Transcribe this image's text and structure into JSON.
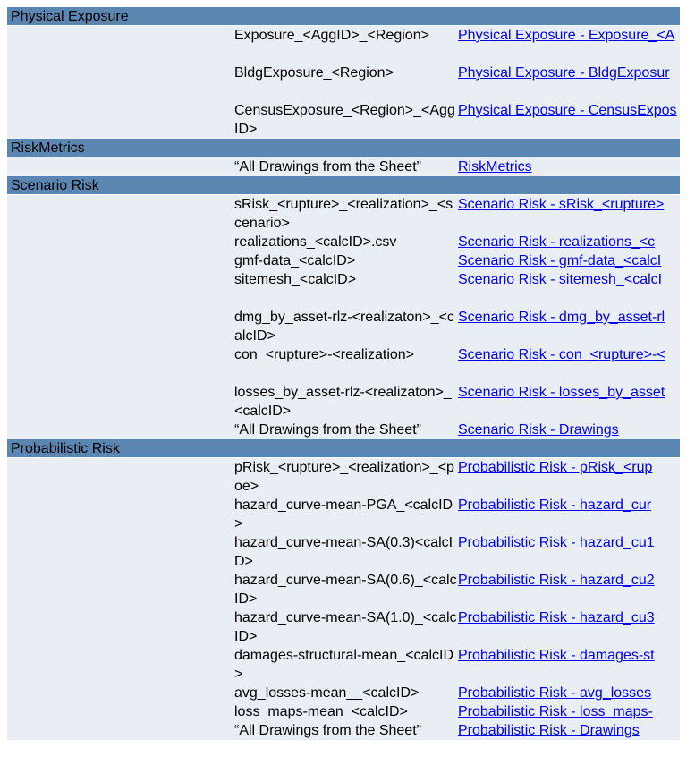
{
  "sections": [
    {
      "title": "Physical Exposure",
      "rows": [
        {
          "name": "Exposure_<AggID>_<Region>",
          "link": "Physical Exposure - Exposure_<A",
          "h": 2,
          "wrap": true
        },
        {
          "name": "BldgExposure_<Region>",
          "link": "Physical Exposure - BldgExposur",
          "h": 2,
          "wrap": false
        },
        {
          "name": "CensusExposure_<Region>_<AggID>",
          "link": "Physical Exposure - CensusExpos",
          "h": 2,
          "wrap": true
        }
      ]
    },
    {
      "title": "RiskMetrics",
      "rows": [
        {
          "name": "“All Drawings from the Sheet”",
          "link": "RiskMetrics",
          "h": 1,
          "wrap": false
        }
      ]
    },
    {
      "title": "Scenario Risk",
      "rows": [
        {
          "name": "sRisk_<rupture>_<realization>_<scenario>",
          "link": "Scenario Risk - sRisk_<rupture>",
          "h": 2,
          "wrap": false
        },
        {
          "name": "realizations_<calcID>.csv",
          "link": "Scenario Risk - realizations_<c",
          "h": 1,
          "wrap": false
        },
        {
          "name": "gmf-data_<calcID>",
          "link": "Scenario Risk - gmf-data_<calcI",
          "h": 1,
          "wrap": false
        },
        {
          "name": "sitemesh_<calcID>",
          "link": "Scenario Risk - sitemesh_<calcI",
          "h": 2,
          "wrap": false
        },
        {
          "name": "dmg_by_asset-rlz-<realizaton>_<calcID>",
          "link": "Scenario Risk - dmg_by_asset-rl",
          "h": 2,
          "wrap": false
        },
        {
          "name": "con_<rupture>-<realization>",
          "link": "Scenario Risk - con_<rupture>-<",
          "h": 2,
          "wrap": false
        },
        {
          "name": "losses_by_asset-rlz-<realizaton>_<calcID>",
          "link": "Scenario Risk - losses_by_asset",
          "h": 2,
          "wrap": false
        },
        {
          "name": "“All Drawings from the Sheet”",
          "link": "Scenario Risk - Drawings",
          "h": 1,
          "wrap": false
        }
      ]
    },
    {
      "title": "Probabilistic Risk",
      "rows": [
        {
          "name": "pRisk_<rupture>_<realization>_<poe>",
          "link": "Probabilistic Risk - pRisk_<rup",
          "h": 2,
          "wrap": false
        },
        {
          "name": "hazard_curve-mean-PGA_<calcID>",
          "link": "Probabilistic Risk - hazard_cur",
          "h": 2,
          "wrap": false
        },
        {
          "name": "hazard_curve-mean-SA(0.3)<calcID>",
          "link": "Probabilistic Risk - hazard_cu1",
          "h": 2,
          "wrap": false
        },
        {
          "name": "hazard_curve-mean-SA(0.6)_<calcID>",
          "link": "Probabilistic Risk - hazard_cu2",
          "h": 2,
          "wrap": false
        },
        {
          "name": "hazard_curve-mean-SA(1.0)_<calcID>",
          "link": "Probabilistic Risk - hazard_cu3",
          "h": 2,
          "wrap": false
        },
        {
          "name": "damages-structural-mean_<calcID>",
          "link": "Probabilistic Risk - damages-st",
          "h": 2,
          "wrap": false
        },
        {
          "name": "avg_losses-mean__<calcID>",
          "link": "Probabilistic Risk - avg_losses",
          "h": 1,
          "wrap": false
        },
        {
          "name": "loss_maps-mean_<calcID>",
          "link": "Probabilistic Risk - loss_maps-",
          "h": 1,
          "wrap": false
        },
        {
          "name": "“All Drawings from the Sheet”",
          "link": "Probabilistic Risk - Drawings",
          "h": 1,
          "wrap": false
        }
      ]
    }
  ]
}
